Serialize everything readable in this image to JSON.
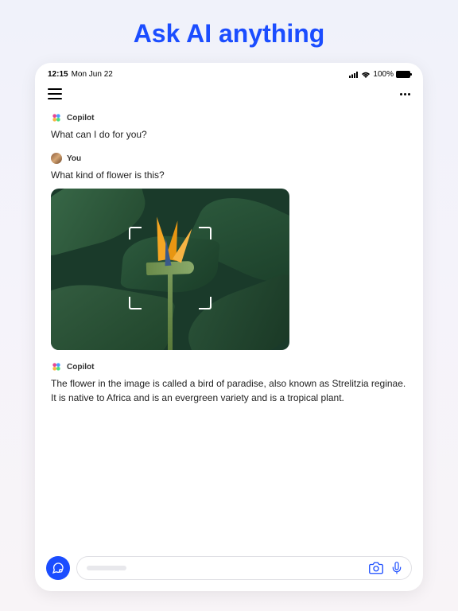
{
  "headline": "Ask AI anything",
  "statusBar": {
    "time": "12:15",
    "date": "Mon Jun 22",
    "batteryPercent": "100%"
  },
  "chat": {
    "copilotName": "Copilot",
    "userName": "You",
    "messages": {
      "greeting": "What can I do for you?",
      "userQuestion": "What kind of flower is this?",
      "answer": "The flower in the image is called a bird of paradise, also known as Strelitzia reginae. It is native to Africa and is an evergreen variety and is a tropical plant."
    }
  },
  "colors": {
    "accent": "#1b4dff"
  }
}
